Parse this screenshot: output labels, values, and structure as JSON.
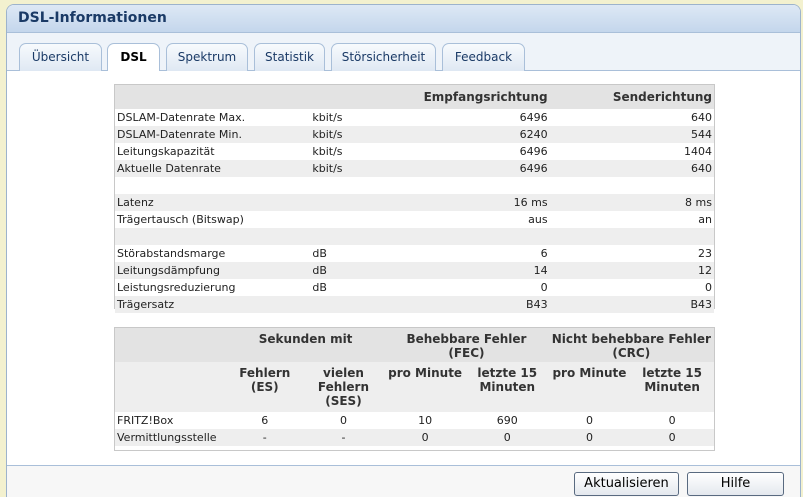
{
  "window": {
    "title": "DSL-Informationen"
  },
  "tabs": [
    {
      "label": "Übersicht"
    },
    {
      "label": "DSL"
    },
    {
      "label": "Spektrum"
    },
    {
      "label": "Statistik"
    },
    {
      "label": "Störsicherheit"
    },
    {
      "label": "Feedback"
    }
  ],
  "active_tab": "DSL",
  "rates": {
    "header": {
      "rx": "Empfangsrichtung",
      "tx": "Senderichtung"
    },
    "rows": [
      {
        "label": "DSLAM-Datenrate Max.",
        "unit": "kbit/s",
        "rx": "6496",
        "tx": "640"
      },
      {
        "label": "DSLAM-Datenrate Min.",
        "unit": "kbit/s",
        "rx": "6240",
        "tx": "544"
      },
      {
        "label": "Leitungskapazität",
        "unit": "kbit/s",
        "rx": "6496",
        "tx": "1404"
      },
      {
        "label": "Aktuelle Datenrate",
        "unit": "kbit/s",
        "rx": "6496",
        "tx": "640"
      },
      {
        "label": "",
        "unit": "",
        "rx": "",
        "tx": ""
      },
      {
        "label": "Latenz",
        "unit": "",
        "rx": "16 ms",
        "tx": "8 ms"
      },
      {
        "label": "Trägertausch (Bitswap)",
        "unit": "",
        "rx": "aus",
        "tx": "an"
      },
      {
        "label": "",
        "unit": "",
        "rx": "",
        "tx": ""
      },
      {
        "label": "Störabstandsmarge",
        "unit": "dB",
        "rx": "6",
        "tx": "23"
      },
      {
        "label": "Leitungsdämpfung",
        "unit": "dB",
        "rx": "14",
        "tx": "12"
      },
      {
        "label": "Leistungsreduzierung",
        "unit": "dB",
        "rx": "0",
        "tx": "0"
      },
      {
        "label": "Trägersatz",
        "unit": "",
        "rx": "B43",
        "tx": "B43"
      }
    ]
  },
  "errors": {
    "groups": {
      "seconds": "Sekunden mit",
      "fec": "Behebbare Fehler (FEC)",
      "crc": "Nicht behebbare Fehler (CRC)"
    },
    "subheaders": {
      "es": "Fehlern (ES)",
      "ses": "vielen Fehlern (SES)",
      "fec_min": "pro Minute",
      "fec_15": "letzte 15 Minuten",
      "crc_min": "pro Minute",
      "crc_15": "letzte 15 Minuten"
    },
    "rows": [
      {
        "label": "FRITZ!Box",
        "es": "6",
        "ses": "0",
        "fec_min": "10",
        "fec_15": "690",
        "crc_min": "0",
        "crc_15": "0"
      },
      {
        "label": "Vermittlungsstelle",
        "es": "-",
        "ses": "-",
        "fec_min": "0",
        "fec_15": "0",
        "crc_min": "0",
        "crc_15": "0"
      }
    ]
  },
  "buttons": {
    "refresh": "Aktualisieren",
    "help": "Hilfe"
  }
}
